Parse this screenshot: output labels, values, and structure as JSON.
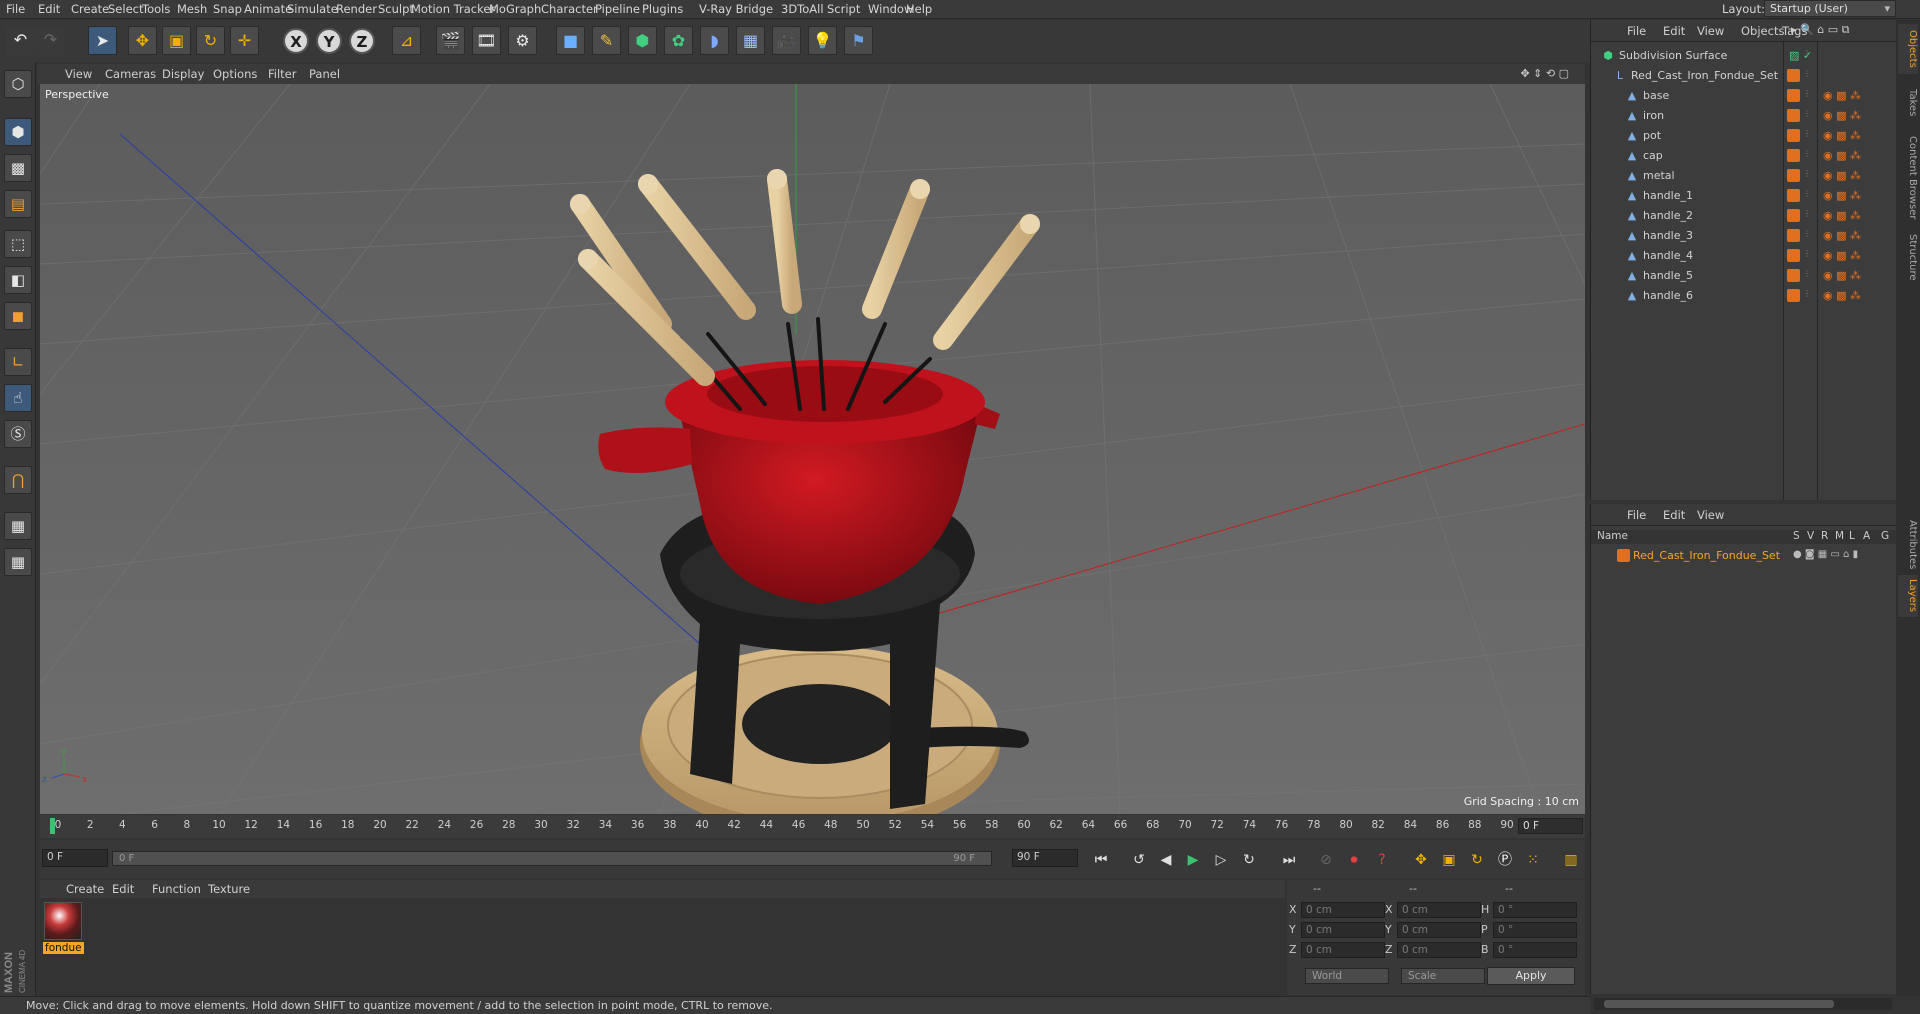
{
  "menubar": {
    "items": [
      "File",
      "Edit",
      "Create",
      "Select",
      "Tools",
      "Mesh",
      "Snap",
      "Animate",
      "Simulate",
      "Render",
      "Sculpt",
      "Motion Tracker",
      "MoGraph",
      "Character",
      "Pipeline",
      "Plugins",
      "V-Ray Bridge",
      "3DToAll",
      "Script",
      "Window",
      "Help"
    ],
    "layout_label": "Layout:",
    "layout_value": "Startup (User)"
  },
  "viewport": {
    "menu": [
      "View",
      "Cameras",
      "Display",
      "Options",
      "Filter",
      "Panel"
    ],
    "camera_label": "Perspective",
    "grid_spacing": "Grid Spacing : 10 cm"
  },
  "timeline": {
    "ticks": [
      "0",
      "2",
      "4",
      "6",
      "8",
      "10",
      "12",
      "14",
      "16",
      "18",
      "20",
      "22",
      "24",
      "26",
      "28",
      "30",
      "32",
      "34",
      "36",
      "38",
      "40",
      "42",
      "44",
      "46",
      "48",
      "50",
      "52",
      "54",
      "56",
      "58",
      "60",
      "62",
      "64",
      "66",
      "68",
      "70",
      "72",
      "74",
      "76",
      "78",
      "80",
      "82",
      "84",
      "86",
      "88",
      "90"
    ],
    "current_frame": "0 F"
  },
  "transport": {
    "start_field": "0 F",
    "slider_start": "0 F",
    "slider_end": "90 F",
    "end_field": "90 F"
  },
  "material_manager": {
    "menu": [
      "Create",
      "Edit",
      "Function",
      "Texture"
    ],
    "material_name": "fondue"
  },
  "coordinates": {
    "header": [
      "--",
      "--",
      "--"
    ],
    "rows": [
      {
        "a": "X",
        "av": "0 cm",
        "b": "X",
        "bv": "0 cm",
        "c": "H",
        "cv": "0 °"
      },
      {
        "a": "Y",
        "av": "0 cm",
        "b": "Y",
        "bv": "0 cm",
        "c": "P",
        "cv": "0 °"
      },
      {
        "a": "Z",
        "av": "0 cm",
        "b": "Z",
        "bv": "0 cm",
        "c": "B",
        "cv": "0 °"
      }
    ],
    "coord_system": "World",
    "mode": "Scale",
    "apply": "Apply"
  },
  "status": "Move: Click and drag to move elements. Hold down SHIFT to quantize movement / add to the selection in point mode, CTRL to remove.",
  "object_manager": {
    "menu": [
      "File",
      "Edit",
      "View",
      "Objects",
      "Tags"
    ],
    "objects": [
      {
        "name": "Subdivision Surface",
        "level": 0
      },
      {
        "name": "Red_Cast_Iron_Fondue_Set",
        "level": 1
      },
      {
        "name": "base",
        "level": 2
      },
      {
        "name": "iron",
        "level": 2
      },
      {
        "name": "pot",
        "level": 2
      },
      {
        "name": "cap",
        "level": 2
      },
      {
        "name": "metal",
        "level": 2
      },
      {
        "name": "handle_1",
        "level": 2
      },
      {
        "name": "handle_2",
        "level": 2
      },
      {
        "name": "handle_3",
        "level": 2
      },
      {
        "name": "handle_4",
        "level": 2
      },
      {
        "name": "handle_5",
        "level": 2
      },
      {
        "name": "handle_6",
        "level": 2
      }
    ]
  },
  "layer_manager": {
    "menu": [
      "File",
      "Edit",
      "View"
    ],
    "columns": [
      "Name",
      "S",
      "V",
      "R",
      "M",
      "L",
      "A",
      "G"
    ],
    "layer_name": "Red_Cast_Iron_Fondue_Set"
  },
  "side_tabs": [
    "Objects",
    "Takes",
    "Content Browser",
    "Structure",
    "Attributes",
    "Layers"
  ],
  "brand": [
    "MAXON",
    "CINEMA 4D"
  ],
  "colors": {
    "accent": "#f5a623",
    "layer_orange": "#e07020",
    "pot_red": "#b0101a"
  }
}
